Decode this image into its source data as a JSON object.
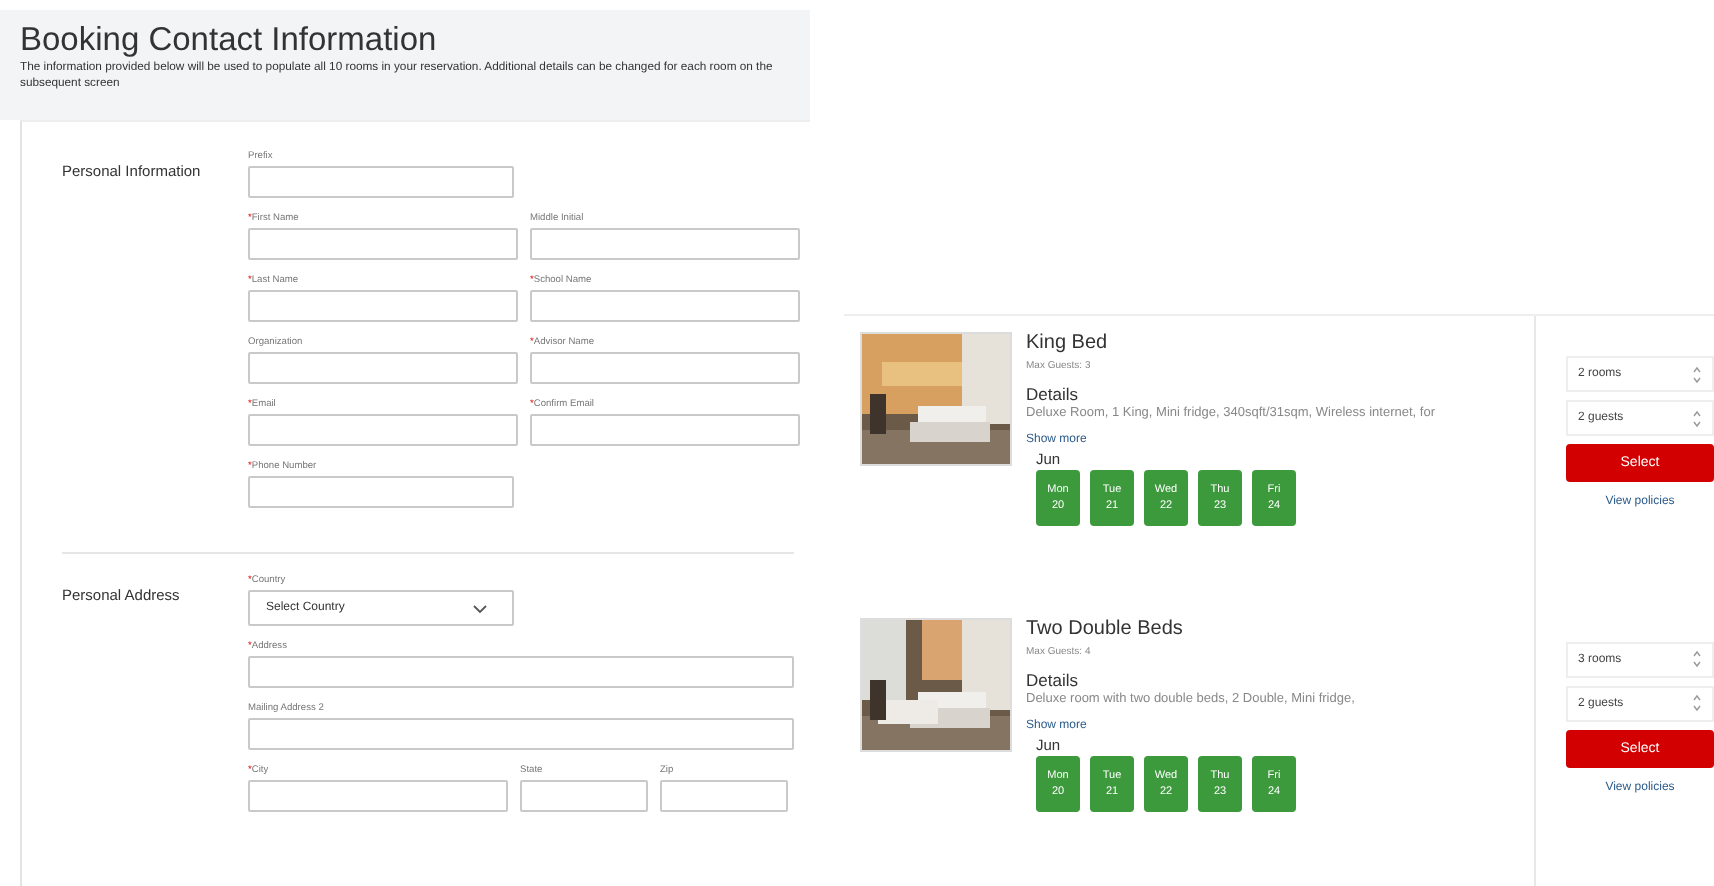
{
  "header": {
    "title": "Booking Contact Information",
    "description": "The information provided below will be used to populate all 10 rooms in your reservation. Additional details can be changed for each room on the subsequent screen"
  },
  "sections": [
    {
      "title": "Personal Information",
      "rows": [
        {
          "kind": "half",
          "fields": [
            {
              "label": "Prefix"
            }
          ]
        },
        {
          "kind": "pair",
          "fields": [
            {
              "label": "First Name",
              "mark": "*"
            },
            {
              "label": "Middle Initial"
            }
          ]
        },
        {
          "kind": "pair",
          "fields": [
            {
              "label": "Last Name",
              "mark": "*"
            },
            {
              "label": "School Name",
              "mark": "*"
            }
          ]
        },
        {
          "kind": "pair",
          "fields": [
            {
              "label": "Organization"
            },
            {
              "label": "Advisor Name",
              "mark": "*"
            }
          ]
        },
        {
          "kind": "pair",
          "fields": [
            {
              "label": "Email",
              "mark": "*"
            },
            {
              "label": "Confirm Email",
              "mark": "*"
            }
          ]
        },
        {
          "kind": "half",
          "fields": [
            {
              "label": "Phone Number",
              "mark": "*"
            }
          ]
        }
      ]
    },
    {
      "title": "Personal Address",
      "rows": [
        {
          "kind": "select",
          "fields": [
            {
              "label": "Country",
              "mark": "*",
              "value": "Select Country"
            }
          ]
        },
        {
          "kind": "full",
          "fields": [
            {
              "label": "Address",
              "mark": "*"
            }
          ]
        },
        {
          "kind": "full",
          "fields": [
            {
              "label": "Mailing Address 2"
            }
          ]
        },
        {
          "kind": "triple",
          "fields": [
            {
              "label": "City",
              "mark": "*"
            },
            {
              "label": "State"
            },
            {
              "label": "Zip"
            }
          ]
        }
      ]
    }
  ],
  "rooms": [
    {
      "name": "King Bed",
      "max_guests": "Max Guests: 3",
      "details_title": "Details",
      "details": "Deluxe Room, 1 King, Mini fridge, 340sqft/31sqm, Wireless internet, for",
      "show_more": "Show more",
      "month": "Jun",
      "days": [
        {
          "day": "Mon",
          "date": "20"
        },
        {
          "day": "Tue",
          "date": "21"
        },
        {
          "day": "Wed",
          "date": "22"
        },
        {
          "day": "Thu",
          "date": "23"
        },
        {
          "day": "Fri",
          "date": "24"
        }
      ],
      "rooms_value": "2 rooms",
      "guests_value": "2 guests",
      "select": "Select",
      "policies": "View policies"
    },
    {
      "name": "Two Double Beds",
      "max_guests": "Max Guests: 4",
      "details_title": "Details",
      "details": "Deluxe room with two double beds, 2 Double, Mini fridge,",
      "show_more": "Show more",
      "month": "Jun",
      "days": [
        {
          "day": "Mon",
          "date": "20"
        },
        {
          "day": "Tue",
          "date": "21"
        },
        {
          "day": "Wed",
          "date": "22"
        },
        {
          "day": "Thu",
          "date": "23"
        },
        {
          "day": "Fri",
          "date": "24"
        }
      ],
      "rooms_value": "3 rooms",
      "guests_value": "2 guests",
      "select": "Select",
      "policies": "View policies"
    }
  ]
}
